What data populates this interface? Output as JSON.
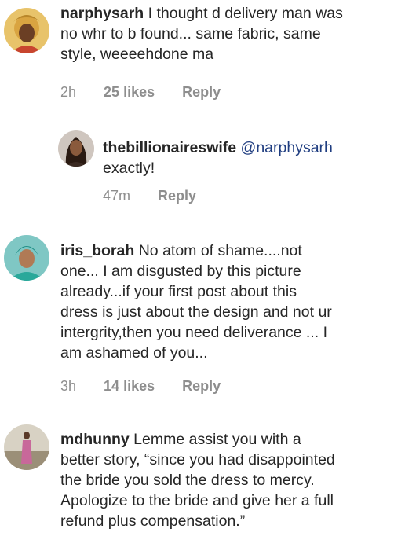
{
  "comments": [
    {
      "username": "narphysarh",
      "lines": [
        "I thought d delivery man was",
        "no whr to b found... same fabric, same",
        "style, weeeehdone ma"
      ],
      "time": "2h",
      "likes": "25 likes",
      "reply": "Reply",
      "avatar_icon": "user-avatar-icon"
    },
    {
      "username": "thebillionaireswife",
      "mention": "@narphysarh",
      "lines": [
        "exactly!"
      ],
      "time": "47m",
      "reply": "Reply",
      "avatar_icon": "user-avatar-icon"
    },
    {
      "username": "iris_borah",
      "lines": [
        "No atom of shame....not",
        "one... I am disgusted by this picture",
        "already...if your first post about this",
        "dress is just about the design and not ur",
        "intergrity,then you need deliverance ... I",
        "am ashamed of you..."
      ],
      "time": "3h",
      "likes": "14 likes",
      "reply": "Reply",
      "avatar_icon": "user-avatar-icon"
    },
    {
      "username": "mdhunny",
      "lines": [
        "Lemme assist you with a",
        "better story, “since you had disappointed",
        "the bride you sold the dress to mercy.",
        "Apologize to the bride and give her a full",
        "refund plus compensation.”"
      ],
      "avatar_icon": "user-avatar-icon"
    }
  ]
}
